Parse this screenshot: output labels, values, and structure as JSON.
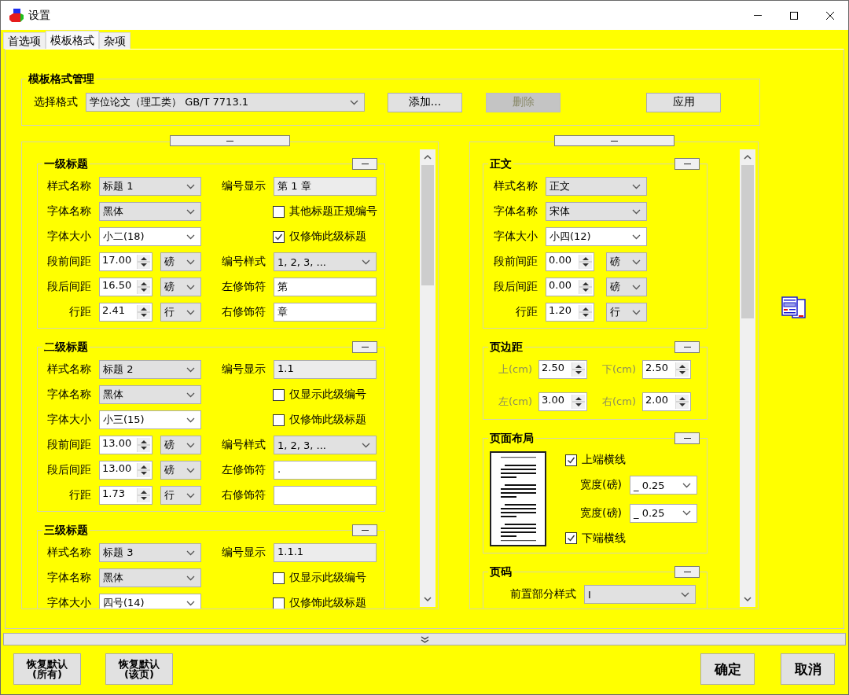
{
  "window": {
    "title": "设置"
  },
  "tabs": [
    {
      "label": "首选项",
      "selected": false
    },
    {
      "label": "模板格式",
      "selected": true
    },
    {
      "label": "杂项",
      "selected": false
    }
  ],
  "template_manager": {
    "title": "模板格式管理",
    "select_label": "选择格式",
    "select_value": "学位论文（理工类） GB/T 7713.1",
    "buttons": [
      {
        "label": "添加...",
        "disabled": false
      },
      {
        "label": "删除",
        "disabled": true
      },
      {
        "label": "应用",
        "disabled": false
      }
    ]
  },
  "left_panel": {
    "sections": [
      {
        "title": "一级标题",
        "left": [
          {
            "kind": "select",
            "label": "样式名称",
            "value": "标题 1",
            "readonly": true
          },
          {
            "kind": "select",
            "label": "字体名称",
            "value": "黑体",
            "readonly": true
          },
          {
            "kind": "select",
            "label": "字体大小",
            "value": "小二(18)",
            "readonly": false
          },
          {
            "kind": "spin",
            "label": "段前间距",
            "value": "17.00",
            "unit": "磅"
          },
          {
            "kind": "spin",
            "label": "段后间距",
            "value": "16.50",
            "unit": "磅"
          },
          {
            "kind": "spin",
            "label": "行距",
            "value": "2.41",
            "unit": "行"
          }
        ],
        "right": [
          {
            "kind": "text",
            "label": "编号显示",
            "value": "第 1 章",
            "readonly": true
          },
          {
            "kind": "checkbox",
            "label": "其他标题正规编号",
            "checked": false
          },
          {
            "kind": "checkbox",
            "label": "仅修饰此级标题",
            "checked": true
          },
          {
            "kind": "select",
            "label": "编号样式",
            "value": "1, 2, 3, ...",
            "readonly": true
          },
          {
            "kind": "text",
            "label": "左修饰符",
            "value": "第",
            "readonly": false
          },
          {
            "kind": "text",
            "label": "右修饰符",
            "value": "章",
            "readonly": false
          }
        ]
      },
      {
        "title": "二级标题",
        "left": [
          {
            "kind": "select",
            "label": "样式名称",
            "value": "标题 2",
            "readonly": true
          },
          {
            "kind": "select",
            "label": "字体名称",
            "value": "黑体",
            "readonly": true
          },
          {
            "kind": "select",
            "label": "字体大小",
            "value": "小三(15)",
            "readonly": false
          },
          {
            "kind": "spin",
            "label": "段前间距",
            "value": "13.00",
            "unit": "磅"
          },
          {
            "kind": "spin",
            "label": "段后间距",
            "value": "13.00",
            "unit": "磅"
          },
          {
            "kind": "spin",
            "label": "行距",
            "value": "1.73",
            "unit": "行"
          }
        ],
        "right": [
          {
            "kind": "text",
            "label": "编号显示",
            "value": "1.1",
            "readonly": true
          },
          {
            "kind": "checkbox",
            "label": "仅显示此级编号",
            "checked": false
          },
          {
            "kind": "checkbox",
            "label": "仅修饰此级标题",
            "checked": false
          },
          {
            "kind": "select",
            "label": "编号样式",
            "value": "1, 2, 3, ...",
            "readonly": true
          },
          {
            "kind": "text",
            "label": "左修饰符",
            "value": ".",
            "readonly": false
          },
          {
            "kind": "text",
            "label": "右修饰符",
            "readonly": false
          }
        ]
      },
      {
        "title": "三级标题",
        "left": [
          {
            "kind": "select",
            "label": "样式名称",
            "value": "标题 3",
            "readonly": true
          },
          {
            "kind": "select",
            "label": "字体名称",
            "value": "黑体",
            "readonly": true
          },
          {
            "kind": "select",
            "label": "字体大小",
            "value": "四号(14)",
            "readonly": false
          }
        ],
        "right": [
          {
            "kind": "text",
            "label": "编号显示",
            "value": "1.1.1",
            "readonly": true
          },
          {
            "kind": "checkbox",
            "label": "仅显示此级编号",
            "checked": false
          },
          {
            "kind": "checkbox",
            "label": "仅修饰此级标题",
            "checked": false
          }
        ]
      }
    ]
  },
  "right_panel": {
    "body": {
      "title": "正文",
      "left": [
        {
          "kind": "select",
          "label": "样式名称",
          "value": "正文",
          "readonly": true
        },
        {
          "kind": "select",
          "label": "字体名称",
          "value": "宋体",
          "readonly": true
        },
        {
          "kind": "select",
          "label": "字体大小",
          "value": "小四(12)",
          "readonly": false
        },
        {
          "kind": "spin",
          "label": "段前间距",
          "value": "0.00",
          "unit": "磅"
        },
        {
          "kind": "spin",
          "label": "段后间距",
          "value": "0.00",
          "unit": "磅"
        },
        {
          "kind": "spin",
          "label": "行距",
          "value": "1.20",
          "unit": "行"
        }
      ]
    },
    "margins": {
      "title": "页边距",
      "fields": [
        {
          "label": "上(cm)",
          "value": "2.50",
          "disabled": true
        },
        {
          "label": "下(cm)",
          "value": "2.50",
          "disabled": true
        },
        {
          "label": "左(cm)",
          "value": "3.00",
          "disabled": true
        },
        {
          "label": "右(cm)",
          "value": "2.00",
          "disabled": true
        }
      ]
    },
    "layout": {
      "title": "页面布局",
      "items": [
        {
          "kind": "checkbox",
          "label": "上端横线",
          "checked": true
        },
        {
          "kind": "select",
          "label": "宽度(磅)",
          "value": "_ 0.25",
          "readonly": false
        },
        {
          "kind": "select",
          "label": "宽度(磅)",
          "value": "_ 0.25",
          "readonly": false
        },
        {
          "kind": "checkbox",
          "label": "下端横线",
          "checked": true
        }
      ]
    },
    "page_number": {
      "title": "页码",
      "fields": [
        {
          "kind": "select",
          "label": "前置部分样式",
          "value": "I",
          "readonly": true
        }
      ]
    }
  },
  "footer": {
    "left_buttons": [
      {
        "label": "恢复默认\n(所有)"
      },
      {
        "label": "恢复默认\n(该页)"
      }
    ],
    "right_buttons": [
      {
        "label": "确定"
      },
      {
        "label": "取消"
      }
    ]
  }
}
